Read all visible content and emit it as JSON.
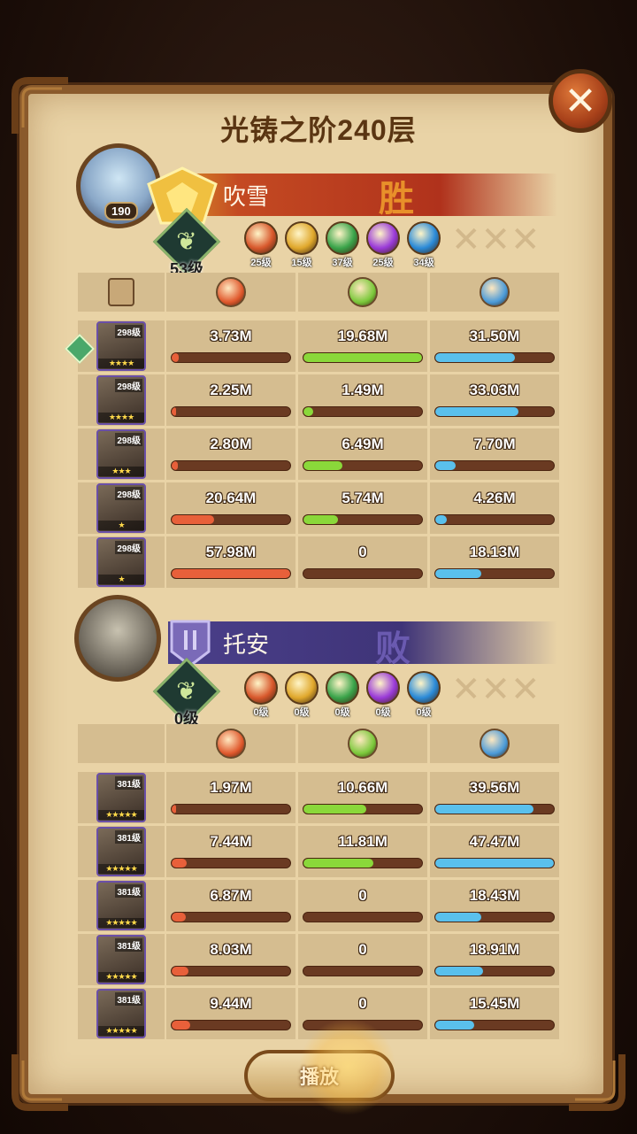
{
  "title": "光铸之阶240层",
  "close_icon": "close-icon",
  "play_label": "播放",
  "teams": [
    {
      "name": "吹雪",
      "result": "胜",
      "avatar_level": "190",
      "team_level": "53级",
      "banner_color": "#b0321c",
      "factions": [
        {
          "icon": "fire-faction-icon",
          "level": "25级",
          "color": "#d8582c"
        },
        {
          "icon": "light-faction-icon",
          "level": "15级",
          "color": "#e0a82c"
        },
        {
          "icon": "nature-faction-icon",
          "level": "37级",
          "color": "#3aa44a"
        },
        {
          "icon": "void-faction-icon",
          "level": "25级",
          "color": "#9a3ad8"
        },
        {
          "icon": "water-faction-icon",
          "level": "34级",
          "color": "#2a8ad8"
        }
      ],
      "heroes": [
        {
          "level": "298级",
          "stars": "★★★★",
          "damage": "3.73M",
          "heal": "19.68M",
          "shield": "31.50M",
          "damage_pct": 6,
          "heal_pct": 100,
          "shield_pct": 67
        },
        {
          "level": "298级",
          "stars": "★★★★",
          "damage": "2.25M",
          "heal": "1.49M",
          "shield": "33.03M",
          "damage_pct": 4,
          "heal_pct": 8,
          "shield_pct": 70
        },
        {
          "level": "298级",
          "stars": "★★★",
          "damage": "2.80M",
          "heal": "6.49M",
          "shield": "7.70M",
          "damage_pct": 5,
          "heal_pct": 33,
          "shield_pct": 17
        },
        {
          "level": "298级",
          "stars": "★",
          "damage": "20.64M",
          "heal": "5.74M",
          "shield": "4.26M",
          "damage_pct": 36,
          "heal_pct": 29,
          "shield_pct": 10
        },
        {
          "level": "298级",
          "stars": "★",
          "damage": "57.98M",
          "heal": "0",
          "shield": "18.13M",
          "damage_pct": 100,
          "heal_pct": 0,
          "shield_pct": 39
        }
      ]
    },
    {
      "name": "托安",
      "result": "败",
      "avatar_level": "",
      "team_level": "0级",
      "banner_color": "#3f3478",
      "factions": [
        {
          "icon": "fire-faction-icon",
          "level": "0级",
          "color": "#d8582c"
        },
        {
          "icon": "light-faction-icon",
          "level": "0级",
          "color": "#e0a82c"
        },
        {
          "icon": "nature-faction-icon",
          "level": "0级",
          "color": "#3aa44a"
        },
        {
          "icon": "void-faction-icon",
          "level": "0级",
          "color": "#9a3ad8"
        },
        {
          "icon": "water-faction-icon",
          "level": "0级",
          "color": "#2a8ad8"
        }
      ],
      "heroes": [
        {
          "level": "381级",
          "stars": "★★★★★",
          "damage": "1.97M",
          "heal": "10.66M",
          "shield": "39.56M",
          "damage_pct": 4,
          "heal_pct": 53,
          "shield_pct": 83
        },
        {
          "level": "381级",
          "stars": "★★★★★",
          "damage": "7.44M",
          "heal": "11.81M",
          "shield": "47.47M",
          "damage_pct": 13,
          "heal_pct": 59,
          "shield_pct": 100
        },
        {
          "level": "381级",
          "stars": "★★★★★",
          "damage": "6.87M",
          "heal": "0",
          "shield": "18.43M",
          "damage_pct": 12,
          "heal_pct": 0,
          "shield_pct": 39
        },
        {
          "level": "381级",
          "stars": "★★★★★",
          "damage": "8.03M",
          "heal": "0",
          "shield": "18.91M",
          "damage_pct": 14,
          "heal_pct": 0,
          "shield_pct": 40
        },
        {
          "level": "381级",
          "stars": "★★★★★",
          "damage": "9.44M",
          "heal": "0",
          "shield": "15.45M",
          "damage_pct": 16,
          "heal_pct": 0,
          "shield_pct": 33
        }
      ]
    }
  ],
  "columns": [
    {
      "icon": "damage-icon",
      "color": "#e0582c"
    },
    {
      "icon": "heal-icon",
      "color": "#7ac83a"
    },
    {
      "icon": "shield-icon",
      "color": "#4a9ad8"
    }
  ],
  "bar_colors": {
    "damage": "#e8603a",
    "heal": "#8ad83a",
    "shield": "#5ac0ec"
  }
}
